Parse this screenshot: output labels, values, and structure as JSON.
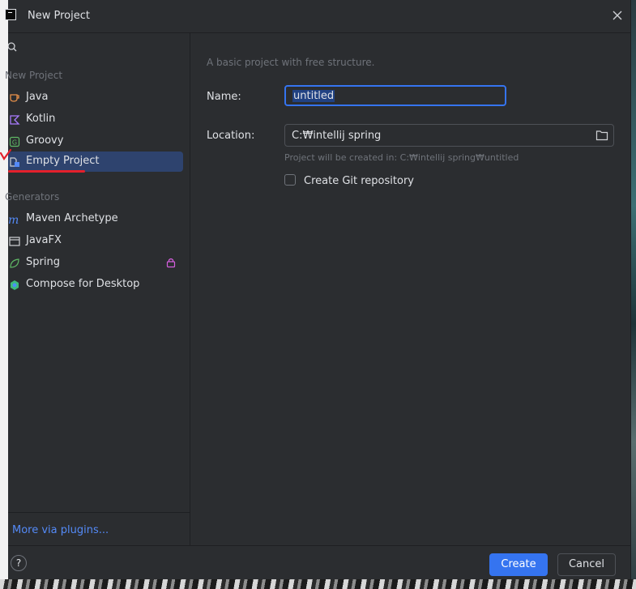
{
  "window": {
    "title": "New Project"
  },
  "search": {
    "placeholder": ""
  },
  "sidebar": {
    "group_new": "New Project",
    "new_items": [
      {
        "label": "Java",
        "icon": "java-cup-icon"
      },
      {
        "label": "Kotlin",
        "icon": "kotlin-icon"
      },
      {
        "label": "Groovy",
        "icon": "groovy-icon"
      },
      {
        "label": "Empty Project",
        "icon": "empty-project-icon",
        "selected": true
      }
    ],
    "group_generators": "Generators",
    "generator_items": [
      {
        "label": "Maven Archetype",
        "icon": "maven-icon"
      },
      {
        "label": "JavaFX",
        "icon": "javafx-window-icon"
      },
      {
        "label": "Spring",
        "icon": "spring-leaf-icon",
        "locked": true
      },
      {
        "label": "Compose for Desktop",
        "icon": "compose-icon"
      }
    ],
    "more_plugins": "More via plugins..."
  },
  "main": {
    "description": "A basic project with free structure.",
    "name_label": "Name:",
    "name_value": "untitled",
    "location_label": "Location:",
    "location_value": "C:₩intellij spring",
    "hint": "Project will be created in: C:₩intellij spring₩untitled",
    "git_label": "Create Git repository",
    "git_checked": false
  },
  "footer": {
    "help": "?",
    "create": "Create",
    "cancel": "Cancel"
  },
  "colors": {
    "accent": "#3574f0",
    "selection": "#2e436e",
    "link": "#548af7",
    "annotation": "#e4202b"
  }
}
